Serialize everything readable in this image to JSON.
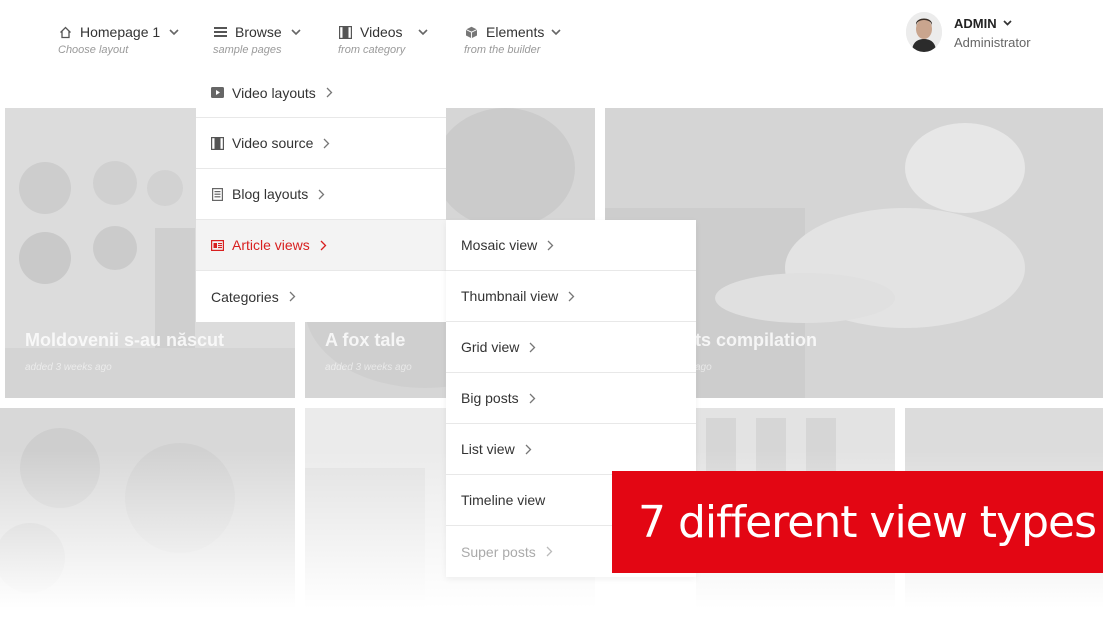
{
  "nav": [
    {
      "label": "Homepage 1",
      "sub": "Choose layout"
    },
    {
      "label": "Browse",
      "sub": "sample pages"
    },
    {
      "label": "Videos",
      "sub": "from category"
    },
    {
      "label": "Elements",
      "sub": "from the builder"
    }
  ],
  "user": {
    "name": "ADMIN",
    "role": "Administrator"
  },
  "browse_menu": [
    {
      "label": "Video layouts",
      "icon": "play-icon"
    },
    {
      "label": "Video source",
      "icon": "film-icon"
    },
    {
      "label": "Blog layouts",
      "icon": "document-icon"
    },
    {
      "label": "Article views",
      "icon": "article-icon",
      "active": true
    },
    {
      "label": "Categories"
    }
  ],
  "article_views_menu": [
    {
      "label": "Mosaic view"
    },
    {
      "label": "Thumbnail view"
    },
    {
      "label": "Grid view"
    },
    {
      "label": "Big posts"
    },
    {
      "label": "List view"
    },
    {
      "label": "Timeline view"
    },
    {
      "label": "Super posts"
    }
  ],
  "tiles": [
    {
      "title": "Moldovenii s-au născut",
      "date": "added 3 weeks ago"
    },
    {
      "title": "A fox tale",
      "date": "added 3 weeks ago"
    },
    {
      "title": "ts compilation",
      "date": "ago"
    }
  ],
  "banner": {
    "text": "7 different view types"
  },
  "colors": {
    "accent": "#d81f1f",
    "banner": "#e30613"
  }
}
